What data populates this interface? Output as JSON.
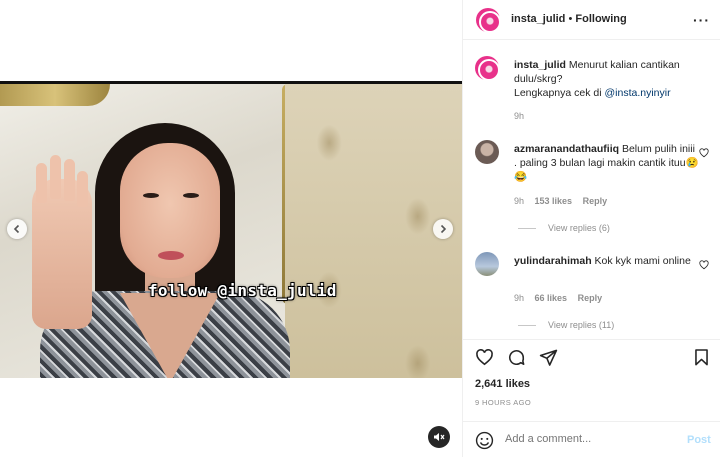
{
  "post": {
    "username": "insta_julid",
    "follow_status": "Following",
    "caption_prefix": "Menurut kalian cantikan dulu/skrg?",
    "caption_line2_text": "Lengkapnya cek di ",
    "caption_mention": "@insta.nyinyir",
    "caption_time": "9h",
    "watermark": "follow @insta_julid"
  },
  "comments": [
    {
      "username": "azmaranandathaufiiq",
      "text": "Belum pulih iniii . paling 3 bulan lagi makin cantik ituu😢😂",
      "time": "9h",
      "likes": "153 likes",
      "reply": "Reply",
      "view_replies": "View replies (6)"
    },
    {
      "username": "yulindarahimah",
      "text": "Kok kyk mami online",
      "time": "9h",
      "likes": "66 likes",
      "reply": "Reply",
      "view_replies": "View replies (11)"
    }
  ],
  "stats": {
    "likes": "2,641 likes",
    "time_ago": "9 HOURS AGO"
  },
  "composer": {
    "placeholder": "Add a comment...",
    "post_label": "Post"
  },
  "icons": {
    "header_more": "more-options-icon",
    "like": "heart-icon",
    "comment": "comment-icon",
    "share": "send-icon",
    "save": "bookmark-icon",
    "emoji": "emoji-icon",
    "mute": "speaker-muted-icon",
    "prev": "chevron-left-icon",
    "next": "chevron-right-icon"
  },
  "colors": {
    "link": "#00376b",
    "muted": "#8e8e8e",
    "post_disabled": "#b2dffc",
    "avatar_brand": "#e8318a"
  }
}
